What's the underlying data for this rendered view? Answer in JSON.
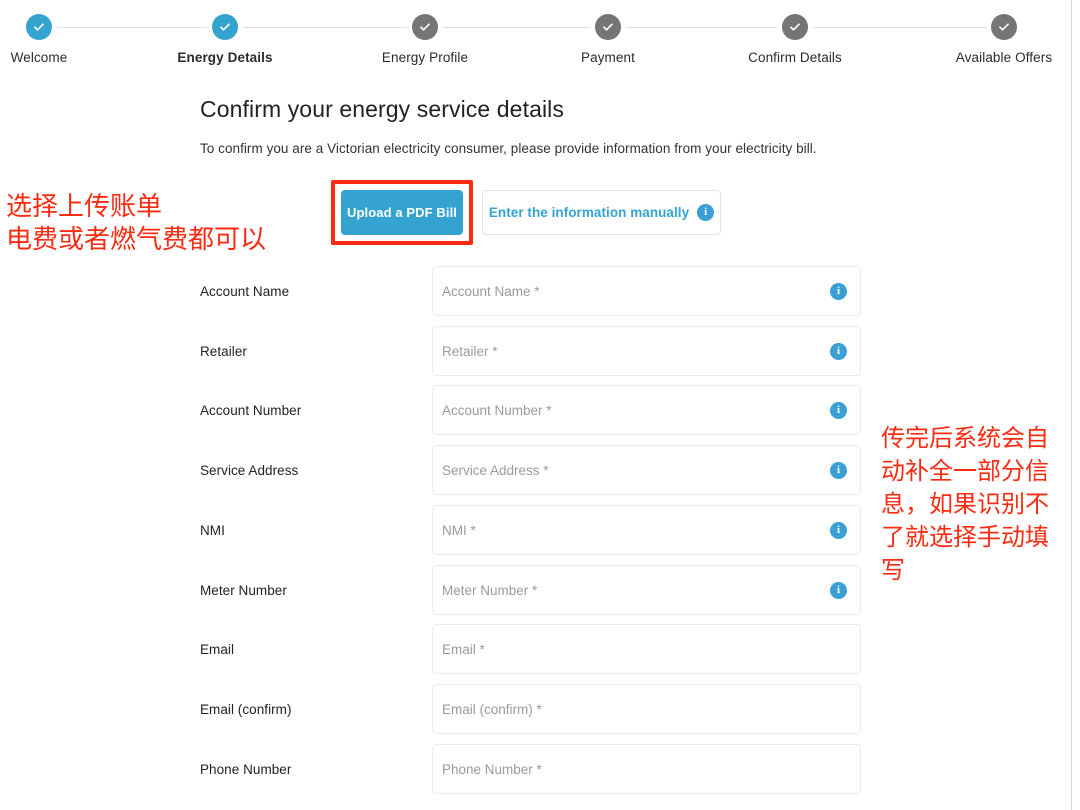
{
  "stepper": {
    "steps": [
      {
        "label": "Welcome",
        "state": "done",
        "active": false
      },
      {
        "label": "Energy Details",
        "state": "done",
        "active": true
      },
      {
        "label": "Energy Profile",
        "state": "todo",
        "active": false
      },
      {
        "label": "Payment",
        "state": "todo",
        "active": false
      },
      {
        "label": "Confirm Details",
        "state": "todo",
        "active": false
      },
      {
        "label": "Available Offers",
        "state": "todo",
        "active": false
      }
    ]
  },
  "main": {
    "title": "Confirm your energy service details",
    "subtitle": "To confirm you are a Victorian electricity consumer, please provide information from your electricity bill.",
    "upload_button_label": "Upload a PDF Bill",
    "manual_button_label": "Enter the information manually",
    "info_glyph": "i"
  },
  "form": {
    "fields": [
      {
        "label": "Account Name",
        "placeholder": "Account Name *",
        "info": true
      },
      {
        "label": "Retailer",
        "placeholder": "Retailer *",
        "info": true
      },
      {
        "label": "Account Number",
        "placeholder": "Account Number *",
        "info": true
      },
      {
        "label": "Service Address",
        "placeholder": "Service Address *",
        "info": true
      },
      {
        "label": "NMI",
        "placeholder": "NMI *",
        "info": true
      },
      {
        "label": "Meter Number",
        "placeholder": "Meter Number *",
        "info": true
      },
      {
        "label": "Email",
        "placeholder": "Email *",
        "info": false
      },
      {
        "label": "Email (confirm)",
        "placeholder": "Email (confirm) *",
        "info": false
      },
      {
        "label": "Phone Number",
        "placeholder": "Phone Number *",
        "info": false
      }
    ]
  },
  "annotations": {
    "left": "选择上传账单\n电费或者燃气费都可以",
    "right": "传完后系统会自动补全一部分信息，如果识别不了就选择手动填写",
    "color": "#fb2b12"
  },
  "colors": {
    "accent_blue": "#35a3d0",
    "step_done": "#35a3d0",
    "step_todo": "#757575",
    "annotation_red": "#fb2b12"
  }
}
